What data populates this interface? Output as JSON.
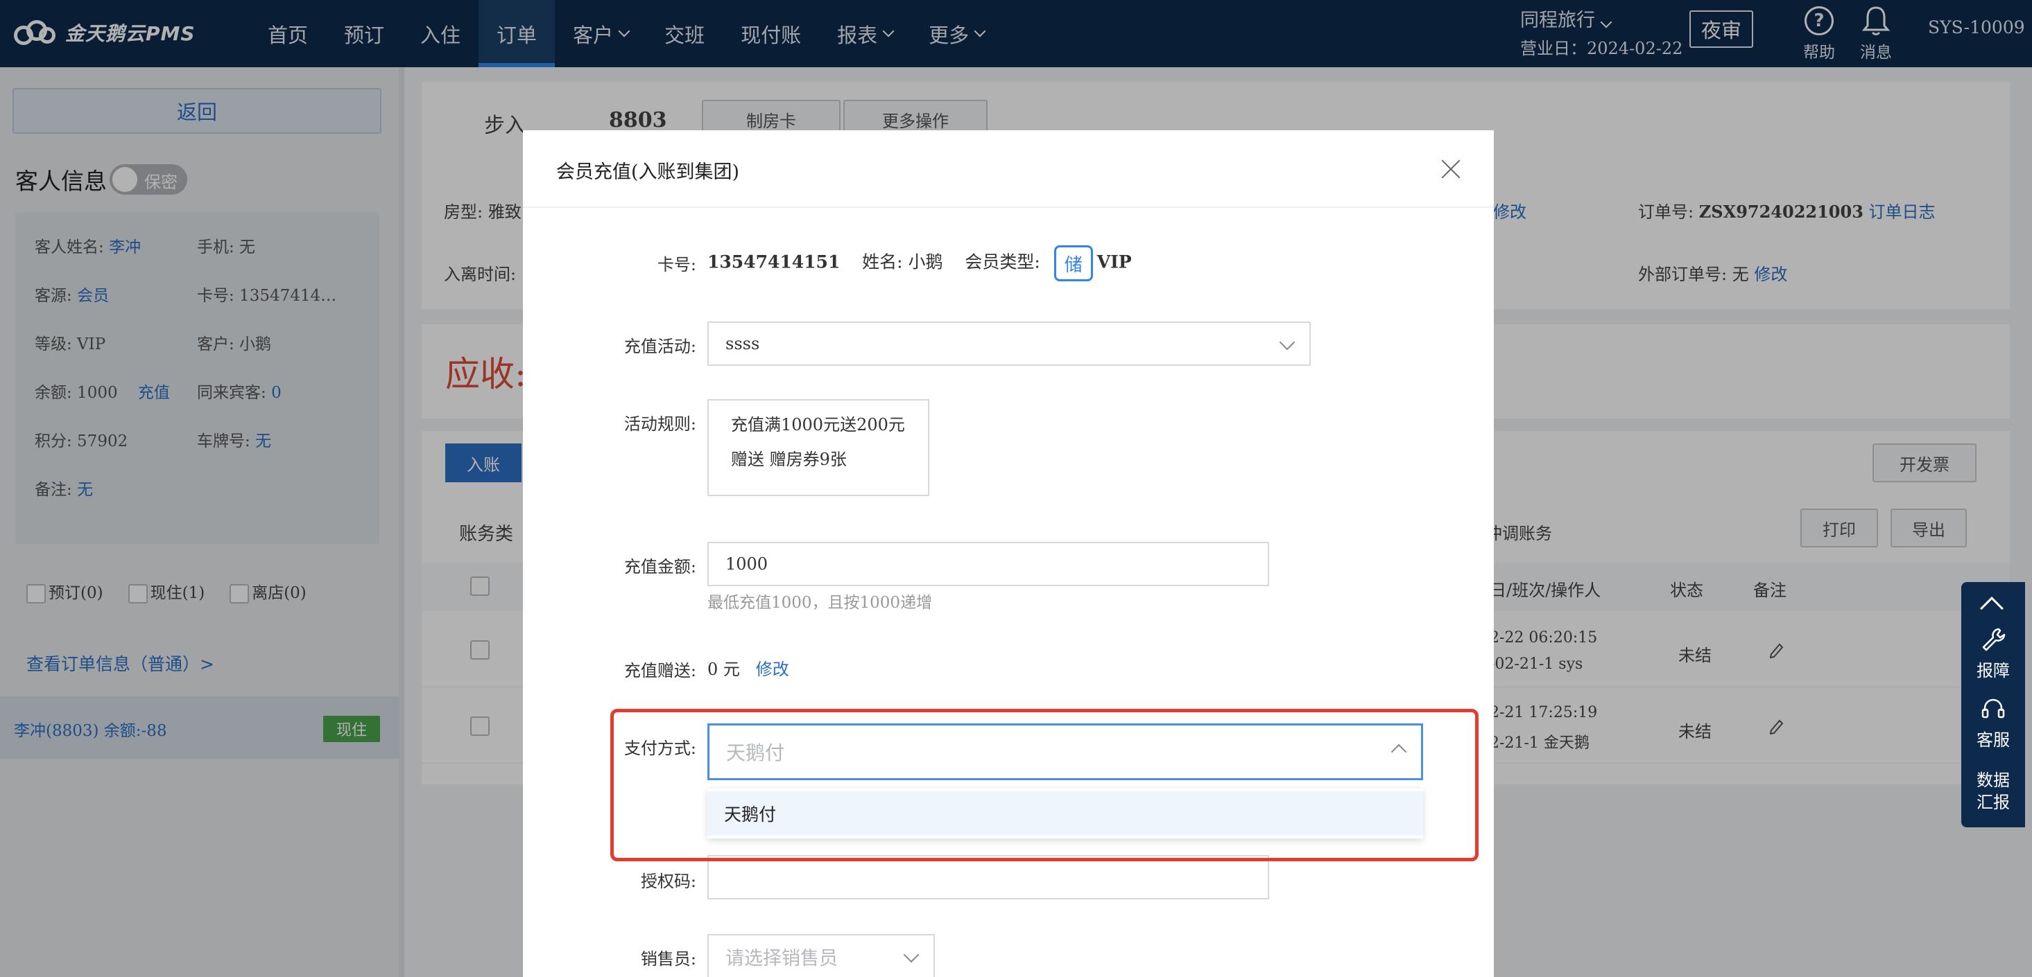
{
  "app": {
    "logo_text": "金天鹅云PMS",
    "nav": [
      "首页",
      "预订",
      "入住",
      "订单",
      "客户",
      "交班",
      "现付账",
      "报表",
      "更多"
    ],
    "nav_active": "订单",
    "hotel_name": "同程旅行",
    "business_date": "营业日：2024-02-22",
    "night_audit": "夜审",
    "help_label": "帮助",
    "message_label": "消息",
    "user": "SYS-10009"
  },
  "left": {
    "back_label": "返回",
    "guest_title": "客人信息",
    "privacy_label": "保密",
    "guest": {
      "name_label": "客人姓名:",
      "name": "李冲",
      "phone": "手机: 无",
      "source_label": "客源:",
      "source": "会员",
      "card": "卡号: 13547414…",
      "level": "等级: VIP",
      "customer": "客户: 小鹅",
      "balance": "余额: 1000",
      "recharge": "充值",
      "companions_label": "同来宾客:",
      "companions": "0",
      "points": "积分: 57902",
      "plate_label": "车牌号:",
      "plate": "无",
      "remark_label": "备注:",
      "remark": "无"
    },
    "filters": [
      "预订(0)",
      "现住(1)",
      "离店(0)"
    ],
    "view_order": "查看订单信息（普通）>",
    "room_row": {
      "text": "李冲(8803)   余额:-88",
      "badge": "现住"
    }
  },
  "main": {
    "room_type_text": "步入",
    "room_no": "8803",
    "make_card": "制房卡",
    "more_ops": "更多操作",
    "room_type_label": "房型: 雅致",
    "checkin_label": "入离时间:",
    "modify": "修改",
    "order_no_label": "订单号:",
    "order_no": "ZSX97240221003",
    "order_log": "订单日志",
    "ext_order_label": "外部订单号:",
    "ext_order": "无",
    "ext_modify": "修改",
    "receivable": "应收:",
    "post_btn": "入账",
    "invoice_btn": "开发票",
    "account_type": "账务类",
    "adjust": "冲调账务",
    "print_btn": "打印",
    "export_btn": "导出",
    "col_shift": "日/班次/操作人",
    "col_status": "状态",
    "col_remark": "备注",
    "rows": [
      {
        "l1": "2-22 06:20:15",
        "l2": "-02-21-1 sys",
        "status": "未结"
      },
      {
        "l1": "2-21 17:25:19",
        "l2": "2-21-1 金天鹅",
        "status": "未结"
      }
    ]
  },
  "modal": {
    "title": "会员充值(入账到集团)",
    "card_label": "卡号:",
    "card_no": "13547414151",
    "name_text": "姓名: 小鹅",
    "member_type_label": "会员类型:",
    "store_tag": "储",
    "member_type": "VIP",
    "activity_label": "充值活动:",
    "activity_value": "ssss",
    "rules_label": "活动规则:",
    "rules": [
      "充值满1000元送200元",
      "赠送 赠房券9张"
    ],
    "amount_label": "充值金额:",
    "amount_value": "1000",
    "amount_hint": "最低充值1000，且按1000递增",
    "gift_label": "充值赠送:",
    "gift_value": "0 元",
    "gift_modify": "修改",
    "pay_label": "支付方式:",
    "pay_placeholder": "天鹅付",
    "pay_option": "天鹅付",
    "auth_label": "授权码:",
    "auth_value": "",
    "sales_label": "销售员:",
    "sales_placeholder": "请选择销售员"
  },
  "float": {
    "report_issue": "报障",
    "service": "客服",
    "data_report": "数据汇报"
  }
}
